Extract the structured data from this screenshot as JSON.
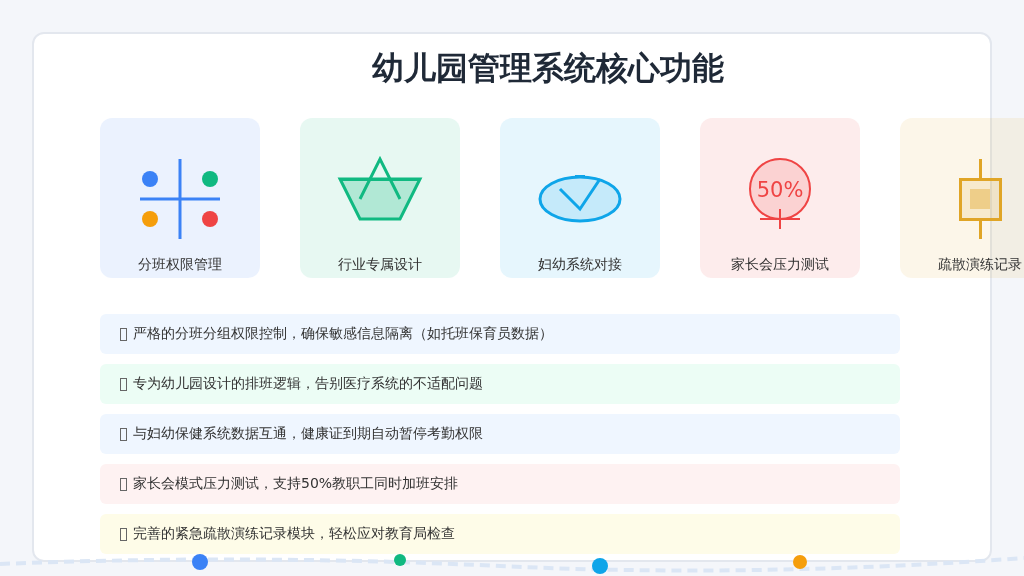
{
  "title": "幼儿园管理系统核心功能",
  "features": [
    {
      "label": "分班权限管理",
      "kind": "grid",
      "color": "#3b82f6"
    },
    {
      "label": "行业专属设计",
      "kind": "basket",
      "color": "#10b981"
    },
    {
      "label": "妇幼系统对接",
      "kind": "ellipse",
      "color": "#0ea5e9"
    },
    {
      "label": "家长会压力测试",
      "kind": "gauge",
      "color": "#ef4444",
      "icon_text": "50%"
    },
    {
      "label": "疏散演练记录",
      "kind": "box",
      "color": "#e0a526"
    }
  ],
  "rows": [
    {
      "text": "严格的分班分组权限控制，确保敏感信息隔离（如托班保育员数据）",
      "color": "#eff6ff"
    },
    {
      "text": "专为幼儿园设计的排班逻辑，告别医疗系统的不适配问题",
      "color": "#ecfdf5"
    },
    {
      "text": "与妇幼保健系统数据互通，健康证到期自动暂停考勤权限",
      "color": "#eff6ff"
    },
    {
      "text": "家长会模式压力测试，支持50%教职工同时加班安排",
      "color": "#fef2f2"
    },
    {
      "text": "完善的紧急疏散演练记录模块，轻松应对教育局检查",
      "color": "#fefce8"
    }
  ]
}
